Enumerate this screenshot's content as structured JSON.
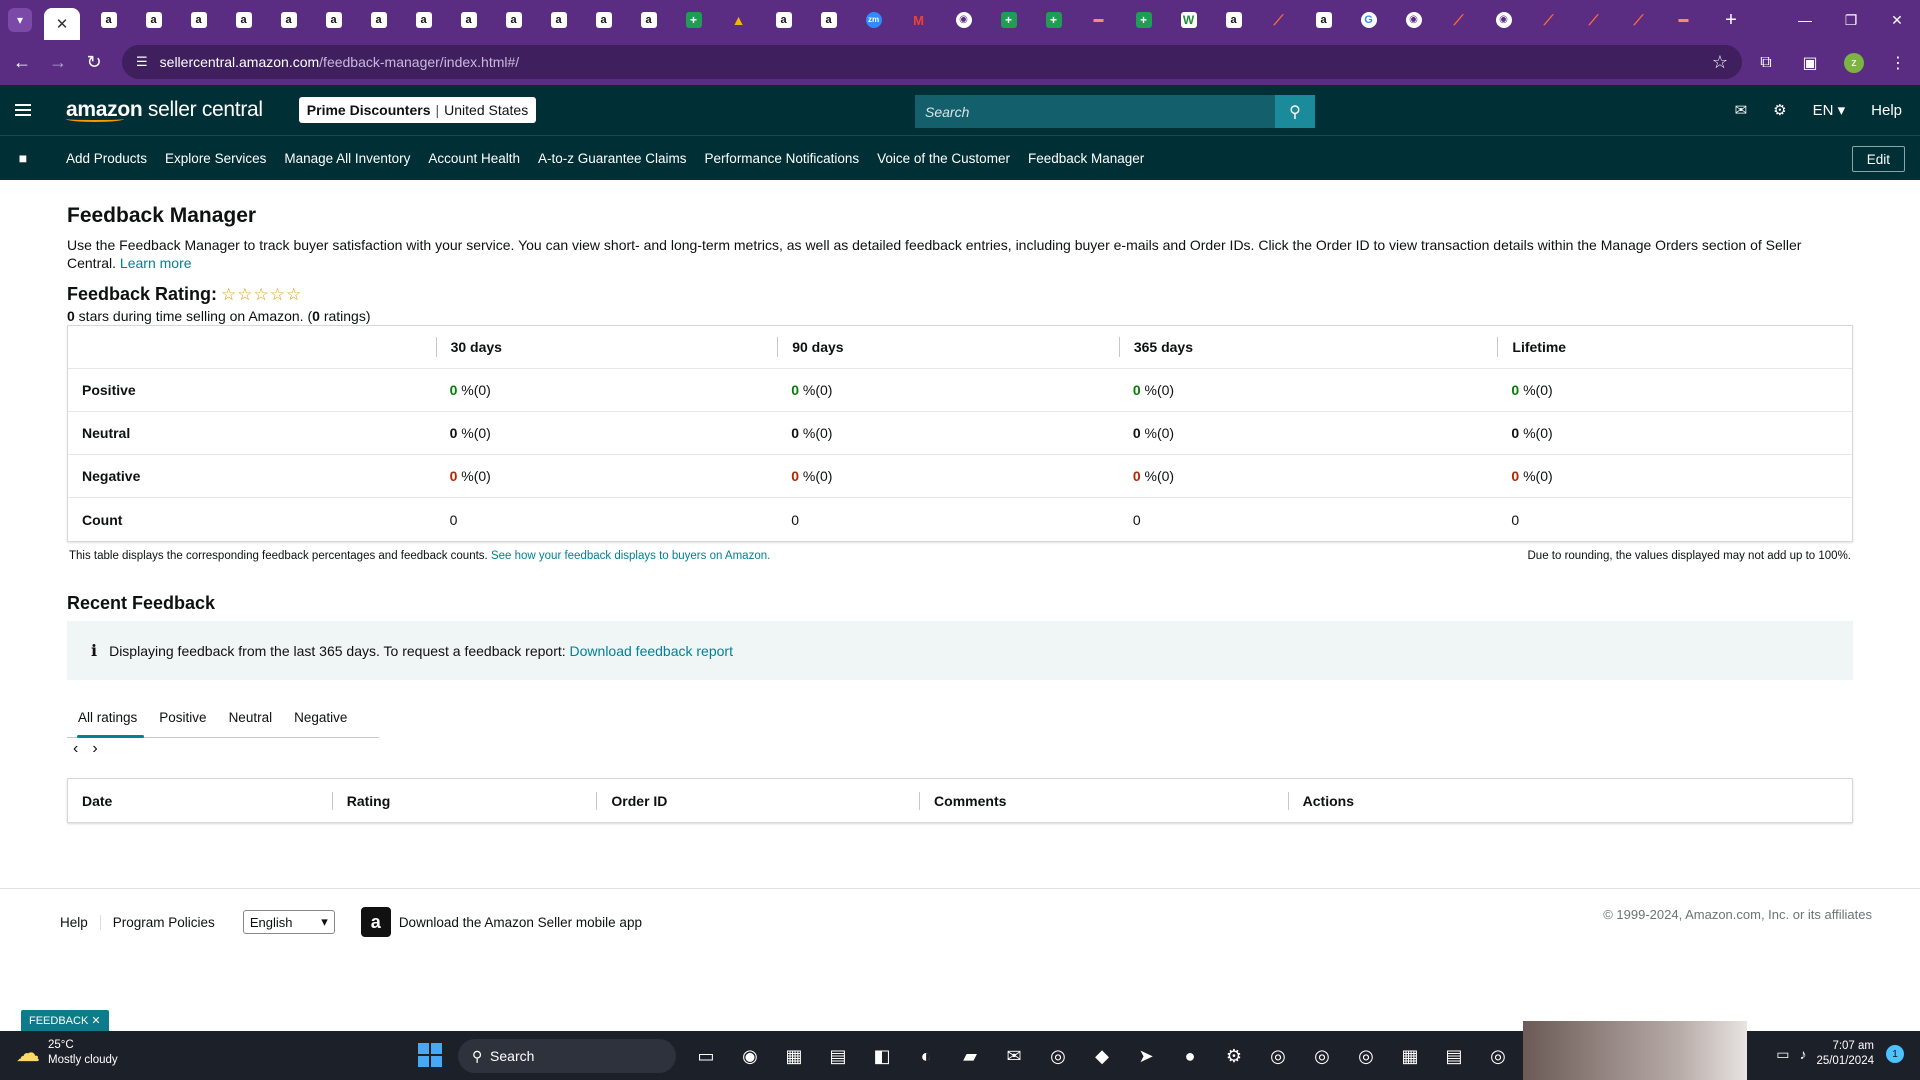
{
  "browser": {
    "active_tab_close": "✕",
    "new_tab": "+",
    "url_host": "sellercentral.amazon.com",
    "url_path": "/feedback-manager/index.html#/",
    "tab_favicons": [
      "amazon",
      "amazon",
      "amazon",
      "amazon",
      "amazon",
      "amazon",
      "amazon",
      "amazon",
      "amazon",
      "amazon",
      "amazon",
      "amazon",
      "amazon",
      "sheets",
      "drive",
      "amazon",
      "amazon",
      "zoom",
      "gmail",
      "chrome",
      "sheets",
      "sheets",
      "misc",
      "sheets",
      "wp",
      "amazon",
      "clickup",
      "amazon",
      "google",
      "chrome",
      "clickup",
      "chrome",
      "clickup",
      "clickup",
      "clickup",
      "misc"
    ]
  },
  "header": {
    "logo_text_bold": "amazon",
    "logo_text": " seller central",
    "store_name": "Prime Discounters",
    "store_region": "United States",
    "search_placeholder": "Search",
    "language": "EN",
    "help": "Help"
  },
  "nav": {
    "items": [
      "Add Products",
      "Explore Services",
      "Manage All Inventory",
      "Account Health",
      "A-to-z Guarantee Claims",
      "Performance Notifications",
      "Voice of the Customer",
      "Feedback Manager"
    ],
    "edit": "Edit"
  },
  "page": {
    "title": "Feedback Manager",
    "intro": "Use the Feedback Manager to track buyer satisfaction with your service. You can view short- and long-term metrics, as well as detailed feedback entries, including buyer e-mails and Order IDs. Click the Order ID to view transaction details within the Manage Orders section of Seller Central.",
    "learn_more": "Learn more",
    "rating_label": "Feedback Rating:",
    "stars_total": 5,
    "stars_filled": 0,
    "rating_stars_value": "0",
    "rating_mid": " stars during time selling on Amazon. (",
    "rating_count": "0",
    "rating_end": " ratings)"
  },
  "feedback_table": {
    "headers": [
      "",
      "30 days",
      "90 days",
      "365 days",
      "Lifetime"
    ],
    "rows": [
      {
        "label": "Positive",
        "kind": "pos",
        "cells": [
          {
            "n": "0",
            "s": " %(0)"
          },
          {
            "n": "0",
            "s": " %(0)"
          },
          {
            "n": "0",
            "s": " %(0)"
          },
          {
            "n": "0",
            "s": " %(0)"
          }
        ]
      },
      {
        "label": "Neutral",
        "kind": "neu",
        "cells": [
          {
            "n": "0",
            "s": " %(0)"
          },
          {
            "n": "0",
            "s": " %(0)"
          },
          {
            "n": "0",
            "s": " %(0)"
          },
          {
            "n": "0",
            "s": " %(0)"
          }
        ]
      },
      {
        "label": "Negative",
        "kind": "neg",
        "cells": [
          {
            "n": "0",
            "s": " %(0)"
          },
          {
            "n": "0",
            "s": " %(0)"
          },
          {
            "n": "0",
            "s": " %(0)"
          },
          {
            "n": "0",
            "s": " %(0)"
          }
        ]
      }
    ],
    "count_label": "Count",
    "counts": [
      "0",
      "0",
      "0",
      "0"
    ],
    "note": "This table displays the corresponding feedback percentages and feedback counts.",
    "note_link": "See how your feedback displays to buyers on Amazon.",
    "rounding_note": "Due to rounding, the values displayed may not add up to 100%."
  },
  "recent": {
    "title": "Recent Feedback",
    "info_text": "Displaying feedback from the last 365 days. To request a feedback report:",
    "info_link": "Download feedback report",
    "tabs": [
      "All ratings",
      "Positive",
      "Neutral",
      "Negative"
    ],
    "active_tab": 0,
    "columns": [
      "Date",
      "Rating",
      "Order ID",
      "Comments",
      "Actions"
    ]
  },
  "footer": {
    "links": [
      "Help",
      "Program Policies"
    ],
    "language_selected": "English",
    "app_promo": "Download the Amazon Seller mobile app",
    "copyright": "© 1999-2024, Amazon.com, Inc. or its affiliates",
    "feedback_tag": "FEEDBACK"
  },
  "taskbar": {
    "temp": "25°C",
    "weather": "Mostly cloudy",
    "search": "Search",
    "time": "7:07 am",
    "date": "25/01/2024",
    "notifications": "1"
  },
  "colors": {
    "positive": "#067d06",
    "negative": "#b12704",
    "header_bg": "#002f36",
    "browser_bg": "#5a2d82",
    "link": "#008296"
  }
}
